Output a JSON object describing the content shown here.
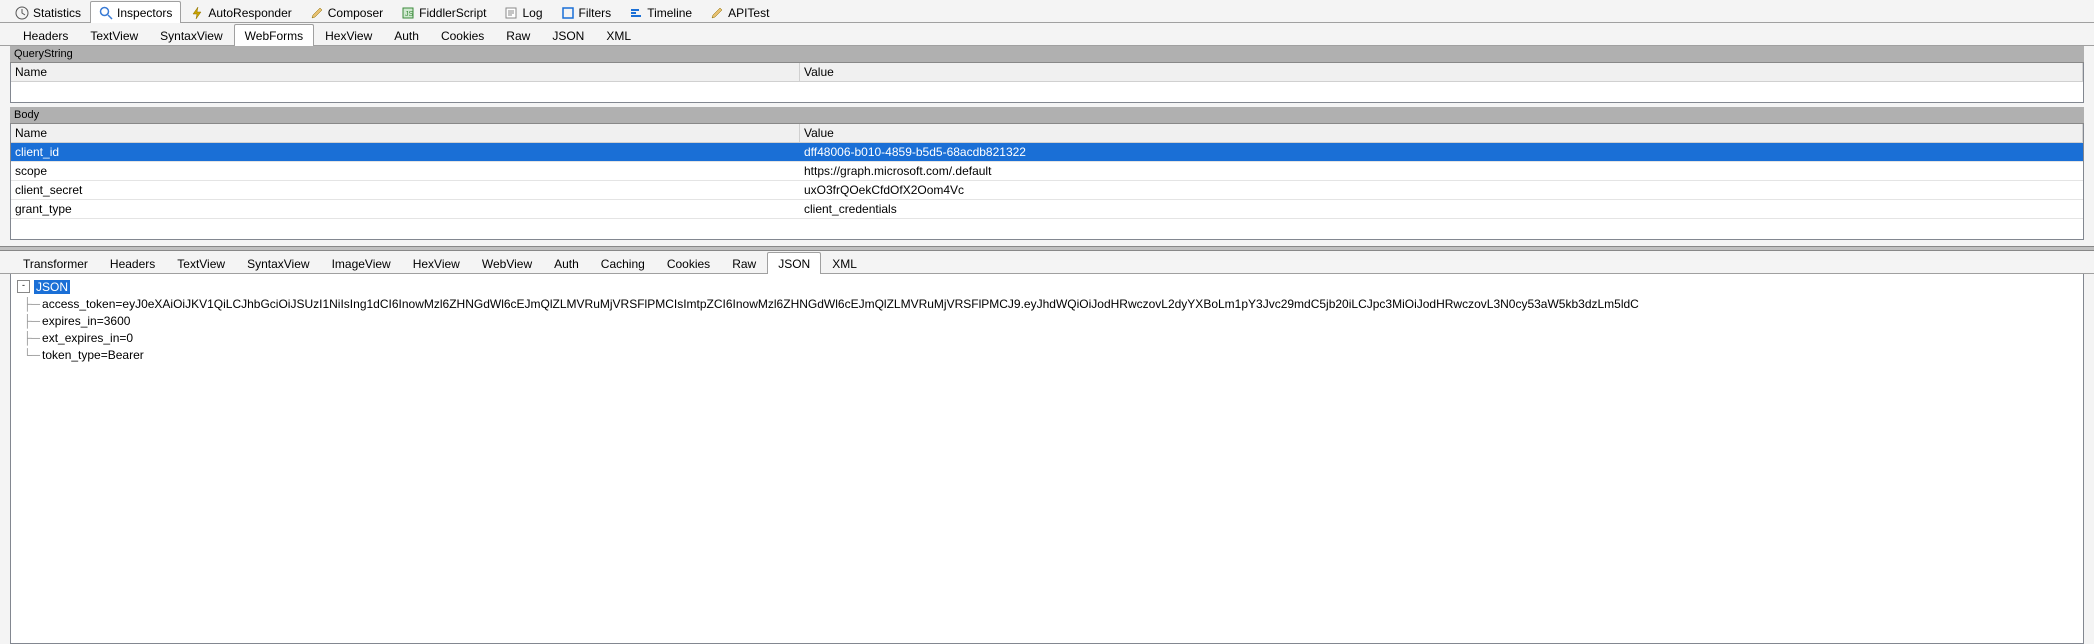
{
  "topTabs": [
    {
      "label": "Statistics",
      "icon": "clock"
    },
    {
      "label": "Inspectors",
      "icon": "magnifier",
      "active": true
    },
    {
      "label": "AutoResponder",
      "icon": "bolt"
    },
    {
      "label": "Composer",
      "icon": "pencil"
    },
    {
      "label": "FiddlerScript",
      "icon": "script"
    },
    {
      "label": "Log",
      "icon": "log"
    },
    {
      "label": "Filters",
      "icon": "square"
    },
    {
      "label": "Timeline",
      "icon": "timeline"
    },
    {
      "label": "APITest",
      "icon": "pencil"
    }
  ],
  "requestSubTabs": [
    "Headers",
    "TextView",
    "SyntaxView",
    "WebForms",
    "HexView",
    "Auth",
    "Cookies",
    "Raw",
    "JSON",
    "XML"
  ],
  "requestSubTabActive": "WebForms",
  "responseSubTabs": [
    "Transformer",
    "Headers",
    "TextView",
    "SyntaxView",
    "ImageView",
    "HexView",
    "WebView",
    "Auth",
    "Caching",
    "Cookies",
    "Raw",
    "JSON",
    "XML"
  ],
  "responseSubTabActive": "JSON",
  "queryStringSection": {
    "title": "QueryString",
    "headers": {
      "name": "Name",
      "value": "Value"
    },
    "rows": []
  },
  "bodySection": {
    "title": "Body",
    "headers": {
      "name": "Name",
      "value": "Value"
    },
    "rows": [
      {
        "name": "client_id",
        "value": "dff48006-b010-4859-b5d5-68acdb821322",
        "selected": true
      },
      {
        "name": "scope",
        "value": "https://graph.microsoft.com/.default"
      },
      {
        "name": "client_secret",
        "value": "uxO3frQOekCfdOfX2Oom4Vc"
      },
      {
        "name": "grant_type",
        "value": "client_credentials"
      }
    ]
  },
  "jsonTree": {
    "root": "JSON",
    "children": [
      {
        "text": "access_token=eyJ0eXAiOiJKV1QiLCJhbGciOiJSUzI1NiIsIng1dCI6InowMzl6ZHNGdWl6cEJmQlZLMVRuMjVRSFlPMCIsImtpZCI6InowMzl6ZHNGdWl6cEJmQlZLMVRuMjVRSFlPMCJ9.eyJhdWQiOiJodHRwczovL2dyYXBoLm1pY3Jvc29mdC5jb20iLCJpc3MiOiJodHRwczovL3N0cy53aW5kb3dzLm5ldC"
      },
      {
        "text": "expires_in=3600"
      },
      {
        "text": "ext_expires_in=0"
      },
      {
        "text": "token_type=Bearer"
      }
    ]
  }
}
